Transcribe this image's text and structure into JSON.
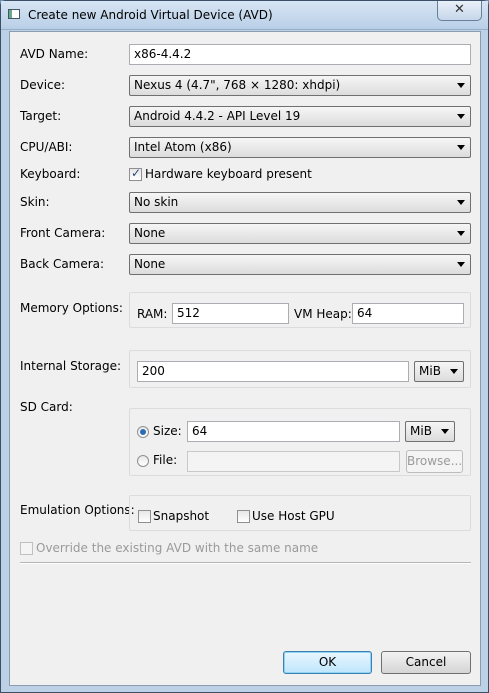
{
  "window": {
    "title": "Create new Android Virtual Device (AVD)",
    "close_glyph": "✕"
  },
  "form": {
    "avd_name_label": "AVD Name:",
    "avd_name_value": "x86-4.4.2",
    "device_label": "Device:",
    "device_value": "Nexus 4 (4.7\", 768 × 1280: xhdpi)",
    "target_label": "Target:",
    "target_value": "Android 4.4.2 - API Level 19",
    "cpu_label": "CPU/ABI:",
    "cpu_value": "Intel Atom (x86)",
    "keyboard_label": "Keyboard:",
    "keyboard_checkbox_label": "Hardware keyboard present",
    "keyboard_checked": true,
    "skin_label": "Skin:",
    "skin_value": "No skin",
    "front_camera_label": "Front Camera:",
    "front_camera_value": "None",
    "back_camera_label": "Back Camera:",
    "back_camera_value": "None"
  },
  "memory": {
    "label": "Memory Options:",
    "ram_label": "RAM:",
    "ram_value": "512",
    "vm_heap_label": "VM Heap:",
    "vm_heap_value": "64"
  },
  "internal_storage": {
    "label": "Internal Storage:",
    "value": "200",
    "unit": "MiB"
  },
  "sd_card": {
    "label": "SD Card:",
    "size_label": "Size:",
    "size_value": "64",
    "size_unit": "MiB",
    "size_selected": true,
    "file_label": "File:",
    "file_value": "",
    "browse_label": "Browse..."
  },
  "emulation": {
    "label": "Emulation Options:",
    "snapshot_label": "Snapshot",
    "snapshot_checked": false,
    "host_gpu_label": "Use Host GPU",
    "host_gpu_checked": false
  },
  "override": {
    "label": "Override the existing AVD with the same name",
    "checked": false
  },
  "buttons": {
    "ok": "OK",
    "cancel": "Cancel"
  },
  "icons": {
    "dropdown": "chevron-down-icon",
    "window": "app-window-icon",
    "close": "close-icon"
  }
}
